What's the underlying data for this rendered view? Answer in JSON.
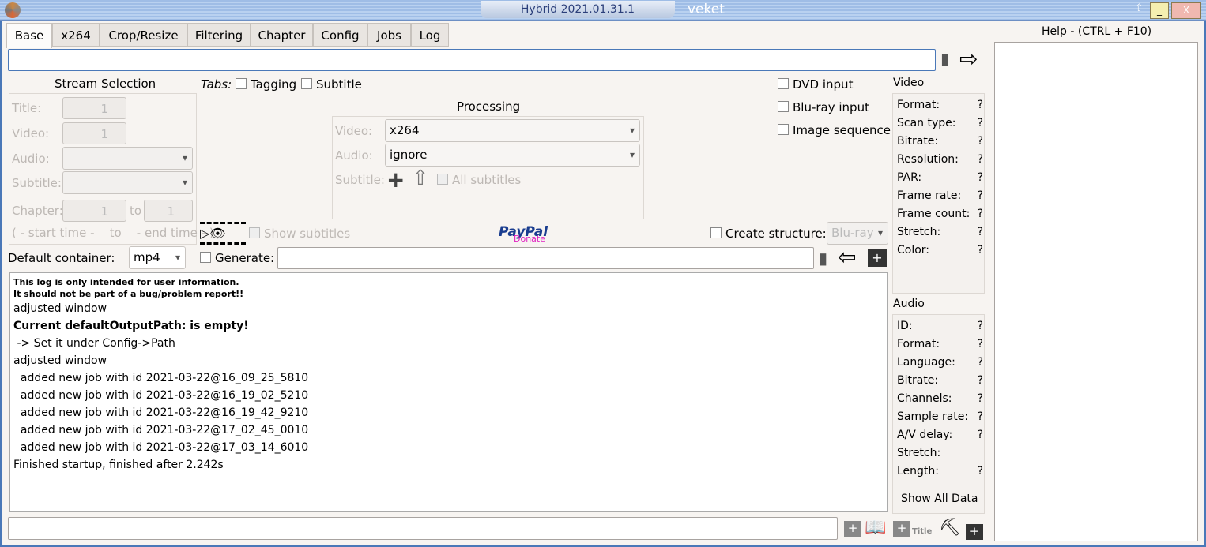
{
  "window": {
    "title": "Hybrid  2021.01.31.1",
    "user": "veket",
    "minimize": "_",
    "close": "X",
    "pin": "⇧"
  },
  "tabs": [
    {
      "label": "Base"
    },
    {
      "label": "x264"
    },
    {
      "label": "Crop/Resize"
    },
    {
      "label": "Filtering"
    },
    {
      "label": "Chapter"
    },
    {
      "label": "Config"
    },
    {
      "label": "Jobs"
    },
    {
      "label": "Log"
    }
  ],
  "help": {
    "title": "Help - (CTRL + F10)"
  },
  "input_file": {
    "value": ""
  },
  "stream_selection": {
    "title": "Stream Selection",
    "title_label": "Title:",
    "title_value": "1",
    "video_label": "Video:",
    "video_value": "1",
    "audio_label": "Audio:",
    "subtitle_label": "Subtitle:",
    "chapter_label": "Chapter:",
    "chapter_from": "1",
    "to": "to",
    "chapter_to": "1",
    "time_range": "( - start time -    to    - end time - )"
  },
  "tabs_options": {
    "label": "Tabs:",
    "tagging": "Tagging",
    "subtitle": "Subtitle"
  },
  "processing": {
    "title": "Processing",
    "video_label": "Video:",
    "video_value": "x264",
    "audio_label": "Audio:",
    "audio_value": "ignore",
    "subtitle_label": "Subtitle:",
    "all_subtitles": "All subtitles"
  },
  "inputs": {
    "dvd": "DVD input",
    "bluray": "Blu-ray input",
    "image_seq": "Image sequence"
  },
  "show_subtitles": "Show subtitles",
  "paypal": {
    "text": "PayPal",
    "donate": "Donate"
  },
  "create_structure": {
    "label": "Create structure:",
    "value": "Blu-ray"
  },
  "default_container": {
    "label": "Default container:",
    "value": "mp4"
  },
  "generate": {
    "label": "Generate:",
    "value": ""
  },
  "video_info": {
    "title": "Video",
    "rows": [
      {
        "k": "Format:",
        "v": "?"
      },
      {
        "k": "Scan type:",
        "v": "?"
      },
      {
        "k": "Bitrate:",
        "v": "?"
      },
      {
        "k": "Resolution:",
        "v": "?"
      },
      {
        "k": "PAR:",
        "v": "?"
      },
      {
        "k": "Frame rate:",
        "v": "?"
      },
      {
        "k": "Frame count:",
        "v": "?"
      },
      {
        "k": "Stretch:",
        "v": "?"
      },
      {
        "k": "Color:",
        "v": "?"
      }
    ]
  },
  "audio_info": {
    "title": "Audio",
    "rows": [
      {
        "k": "ID:",
        "v": "?"
      },
      {
        "k": "Format:",
        "v": "?"
      },
      {
        "k": "Language:",
        "v": "?"
      },
      {
        "k": "Bitrate:",
        "v": "?"
      },
      {
        "k": "Channels:",
        "v": "?"
      },
      {
        "k": "Sample rate:",
        "v": "?"
      },
      {
        "k": "A/V delay:",
        "v": "?"
      },
      {
        "k": "Stretch:",
        "v": ""
      },
      {
        "k": "Length:",
        "v": "?"
      }
    ],
    "show_all": "Show All Data"
  },
  "log": {
    "notice1": "This log is only intended for user information.",
    "notice2": "It should not be part of a bug/problem report!!",
    "lines": [
      {
        "t": "adjusted window",
        "b": false
      },
      {
        "t": "Current defaultOutputPath: is empty!",
        "b": true
      },
      {
        "t": " -> Set it under Config->Path",
        "b": false
      },
      {
        "t": "adjusted window",
        "b": false
      },
      {
        "t": "  added new job with id 2021-03-22@16_09_25_5810",
        "b": false
      },
      {
        "t": "  added new job with id 2021-03-22@16_19_02_5210",
        "b": false
      },
      {
        "t": "  added new job with id 2021-03-22@16_19_42_9210",
        "b": false
      },
      {
        "t": "  added new job with id 2021-03-22@17_02_45_0010",
        "b": false
      },
      {
        "t": "  added new job with id 2021-03-22@17_03_14_6010",
        "b": false
      },
      {
        "t": "Finished startup, finished after 2.242s",
        "b": false
      }
    ]
  },
  "bottom": {
    "job_name": "",
    "title_label": "Title"
  }
}
